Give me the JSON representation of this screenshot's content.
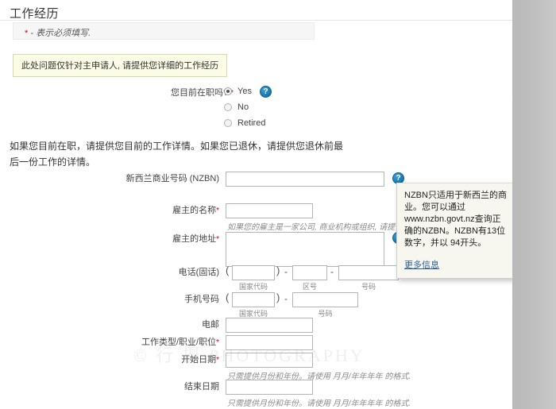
{
  "page": {
    "title": "工作经历",
    "required_note": "- 表示必须填写.",
    "required_marker": "*",
    "notice": "此处问题仅针对主申请人, 请提供您详细的工作经历",
    "intro": "如果您目前在职，请提供您目前的工作详情。如果您已退休，请提供您退休前最后一份工作的详情。"
  },
  "employment_question": {
    "label": "您目前在职吗?",
    "required": true,
    "options": [
      {
        "label": "Yes",
        "selected": true
      },
      {
        "label": "No",
        "selected": false
      },
      {
        "label": "Retired",
        "selected": false
      }
    ],
    "help_icon": "help-circle-icon"
  },
  "fields": {
    "nzbn": {
      "label": "新西兰商业号码 (NZBN)",
      "value": "",
      "required": false,
      "help_icon": "help-circle-icon"
    },
    "employer_name": {
      "label": "雇主的名称",
      "value": "",
      "required": true,
      "hint": "如果您的雇主是一家公司, 商业机构或组织, 请提供该公司 商"
    },
    "employer_address": {
      "label": "雇主的地址",
      "value": "",
      "required": true,
      "help_icon": "help-circle-icon"
    },
    "phone_landline": {
      "label": "电话(固话)",
      "required": false,
      "country_code": {
        "label": "国家代码",
        "value": ""
      },
      "area_code": {
        "label": "区号",
        "value": ""
      },
      "number": {
        "label": "号码",
        "value": ""
      }
    },
    "mobile": {
      "label": "手机号码",
      "required": false,
      "country_code": {
        "label": "国家代码",
        "value": ""
      },
      "number": {
        "label": "号码",
        "value": ""
      }
    },
    "email": {
      "label": "电邮",
      "value": "",
      "required": false
    },
    "job_type": {
      "label": "工作类型/职业/职位",
      "value": "",
      "required": true
    },
    "start_date": {
      "label": "开始日期",
      "value": "",
      "required": true,
      "hint": "只需提供月份和年份。请使用 月月/年年年年 的格式."
    },
    "end_date": {
      "label": "结束日期",
      "value": "",
      "required": false,
      "hint": "只需提供月份和年份。请使用 月月/年年年年 的格式."
    }
  },
  "tooltip": {
    "text": "NZBN只适用于新西兰的商业。您可以通过www.nzbn.govt.nz查询正确的NZBN。NZBN有13位数字，并以 94开头。",
    "link": "更多信息"
  },
  "watermark": {
    "text": "© 行 摄 PHOTOGRAPHY"
  },
  "colors": {
    "required_star": "#d0021b",
    "help_icon": "#1f7fb5",
    "notice_bg": "#fbfbe6",
    "notice_border": "#d9d9a8",
    "tooltip_bg": "#f7f7ef",
    "link": "#2a5f95",
    "gutter": "#c0c0c0"
  }
}
